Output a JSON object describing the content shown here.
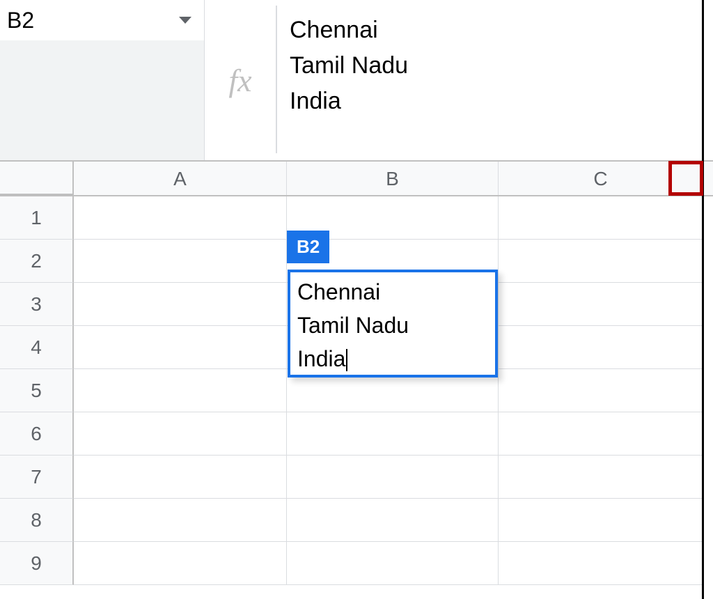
{
  "name_box": {
    "value": "B2"
  },
  "formula_bar": {
    "fx_label": "fx",
    "lines": [
      "Chennai",
      "Tamil Nadu",
      "India"
    ]
  },
  "columns": [
    "A",
    "B",
    "C"
  ],
  "rows": [
    "1",
    "2",
    "3",
    "4",
    "5",
    "6",
    "7",
    "8",
    "9"
  ],
  "active_cell": {
    "ref": "B2",
    "badge": "B2",
    "lines": [
      "Chennai",
      "Tamil Nadu",
      "India"
    ]
  }
}
